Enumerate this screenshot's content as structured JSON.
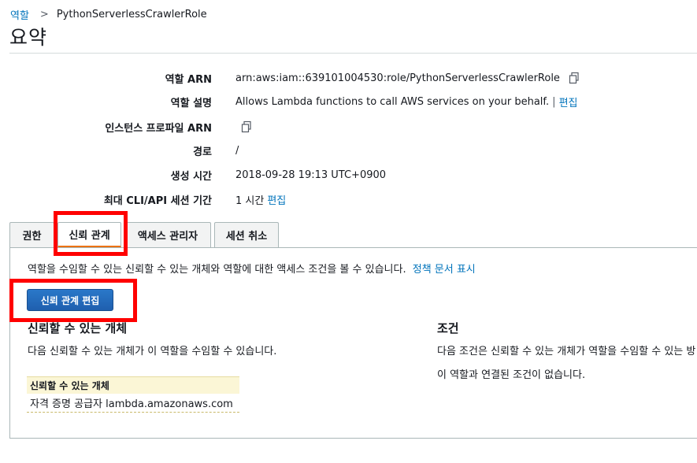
{
  "breadcrumb": {
    "parent": "역할",
    "separator": ">",
    "current": "PythonServerlessCrawlerRole"
  },
  "page_title": "요약",
  "summary": [
    {
      "label": "역할 ARN",
      "value": "arn:aws:iam::639101004530:role/PythonServerlessCrawlerRole",
      "copy_icon": true
    },
    {
      "label": "역할 설명",
      "value": "Allows Lambda functions to call AWS services on your behalf.",
      "separator": "|",
      "link": "편집"
    },
    {
      "label": "인스턴스 프로파일 ARN",
      "value": "",
      "copy_icon": true
    },
    {
      "label": "경로",
      "value": "/"
    },
    {
      "label": "생성 시간",
      "value": "2018-09-28 19:13 UTC+0900"
    },
    {
      "label": "최대 CLI/API 세션 기간",
      "value": "1 시간",
      "link": "편집"
    }
  ],
  "tabs": [
    {
      "label": "권한",
      "active": false
    },
    {
      "label": "신뢰 관계",
      "active": true
    },
    {
      "label": "액세스 관리자",
      "active": false
    },
    {
      "label": "세션 취소",
      "active": false
    }
  ],
  "trust": {
    "description": "역할을 수임할 수 있는 신뢰할 수 있는 개체와 역할에 대한 액세스 조건을 볼 수 있습니다.",
    "policy_link": "정책 문서 표시",
    "edit_button": "신뢰 관계 편집",
    "entities_title": "신뢰할 수 있는 개체",
    "entities_text": "다음 신뢰할 수 있는 개체가 이 역할을 수임할 수 있습니다.",
    "entities_header": "신뢰할 수 있는 개체",
    "entities": [
      "자격 증명 공급자 lambda.amazonaws.com"
    ],
    "conditions_title": "조건",
    "conditions_text": "다음 조건은 신뢰할 수 있는 개체가 역할을 수임할 수 있는 방",
    "conditions_empty": "이 역할과 연결된 조건이 없습니다."
  },
  "colors": {
    "link": "#0073bb",
    "highlight": "#ff0000",
    "active_tab": "#ec7211",
    "primary_button": "#1f5fae"
  },
  "icons": {
    "copy": "copy-icon"
  }
}
